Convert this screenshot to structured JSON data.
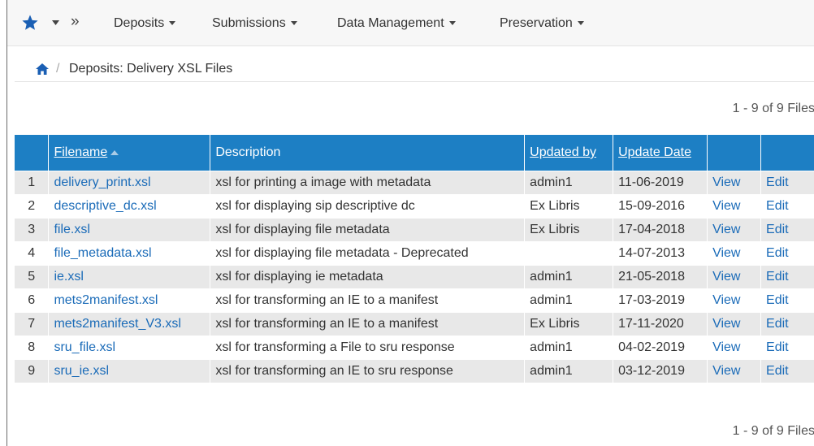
{
  "nav": {
    "menus": [
      {
        "label": "Deposits"
      },
      {
        "label": "Submissions"
      },
      {
        "label": "Data Management"
      },
      {
        "label": "Preservation"
      }
    ],
    "star_icon": "star-icon",
    "more_icon": "double-chevron-right-icon"
  },
  "breadcrumb": {
    "home_icon": "home-icon",
    "separator": "/",
    "current": "Deposits: Delivery XSL Files"
  },
  "pagination": {
    "summary": "1 - 9 of 9 Files"
  },
  "table": {
    "headers": {
      "index": "",
      "filename": "Filename",
      "description": "Description",
      "updated_by": "Updated by",
      "update_date": "Update Date",
      "view": "",
      "edit": ""
    },
    "sort": {
      "column": "Filename",
      "direction": "ascending"
    },
    "rows": [
      {
        "index": "1",
        "filename": "delivery_print.xsl",
        "description": "xsl for printing a image with metadata",
        "updated_by": "admin1",
        "update_date": "11-06-2019",
        "view": "View",
        "edit": "Edit"
      },
      {
        "index": "2",
        "filename": "descriptive_dc.xsl",
        "description": "xsl for displaying sip descriptive dc",
        "updated_by": "Ex Libris",
        "update_date": "15-09-2016",
        "view": "View",
        "edit": "Edit"
      },
      {
        "index": "3",
        "filename": "file.xsl",
        "description": "xsl for displaying file metadata",
        "updated_by": "Ex Libris",
        "update_date": "17-04-2018",
        "view": "View",
        "edit": "Edit"
      },
      {
        "index": "4",
        "filename": "file_metadata.xsl",
        "description": "xsl for displaying file metadata - Deprecated",
        "updated_by": "",
        "update_date": "14-07-2013",
        "view": "View",
        "edit": "Edit"
      },
      {
        "index": "5",
        "filename": "ie.xsl",
        "description": "xsl for displaying ie metadata",
        "updated_by": "admin1",
        "update_date": "21-05-2018",
        "view": "View",
        "edit": "Edit"
      },
      {
        "index": "6",
        "filename": "mets2manifest.xsl",
        "description": "xsl for transforming an IE to a manifest",
        "updated_by": "admin1",
        "update_date": "17-03-2019",
        "view": "View",
        "edit": "Edit"
      },
      {
        "index": "7",
        "filename": "mets2manifest_V3.xsl",
        "description": "xsl for transforming an IE to a manifest",
        "updated_by": "Ex Libris",
        "update_date": "17-11-2020",
        "view": "View",
        "edit": "Edit"
      },
      {
        "index": "8",
        "filename": "sru_file.xsl",
        "description": "xsl for transforming a File to sru response",
        "updated_by": "admin1",
        "update_date": "04-02-2019",
        "view": "View",
        "edit": "Edit"
      },
      {
        "index": "9",
        "filename": "sru_ie.xsl",
        "description": "xsl for transforming an IE to sru response",
        "updated_by": "admin1",
        "update_date": "03-12-2019",
        "view": "View",
        "edit": "Edit"
      }
    ]
  },
  "colors": {
    "header_bg": "#1d7fc4",
    "link": "#1a6bb8",
    "star": "#1a5fb4",
    "row_alt": "#e8e8e8"
  }
}
